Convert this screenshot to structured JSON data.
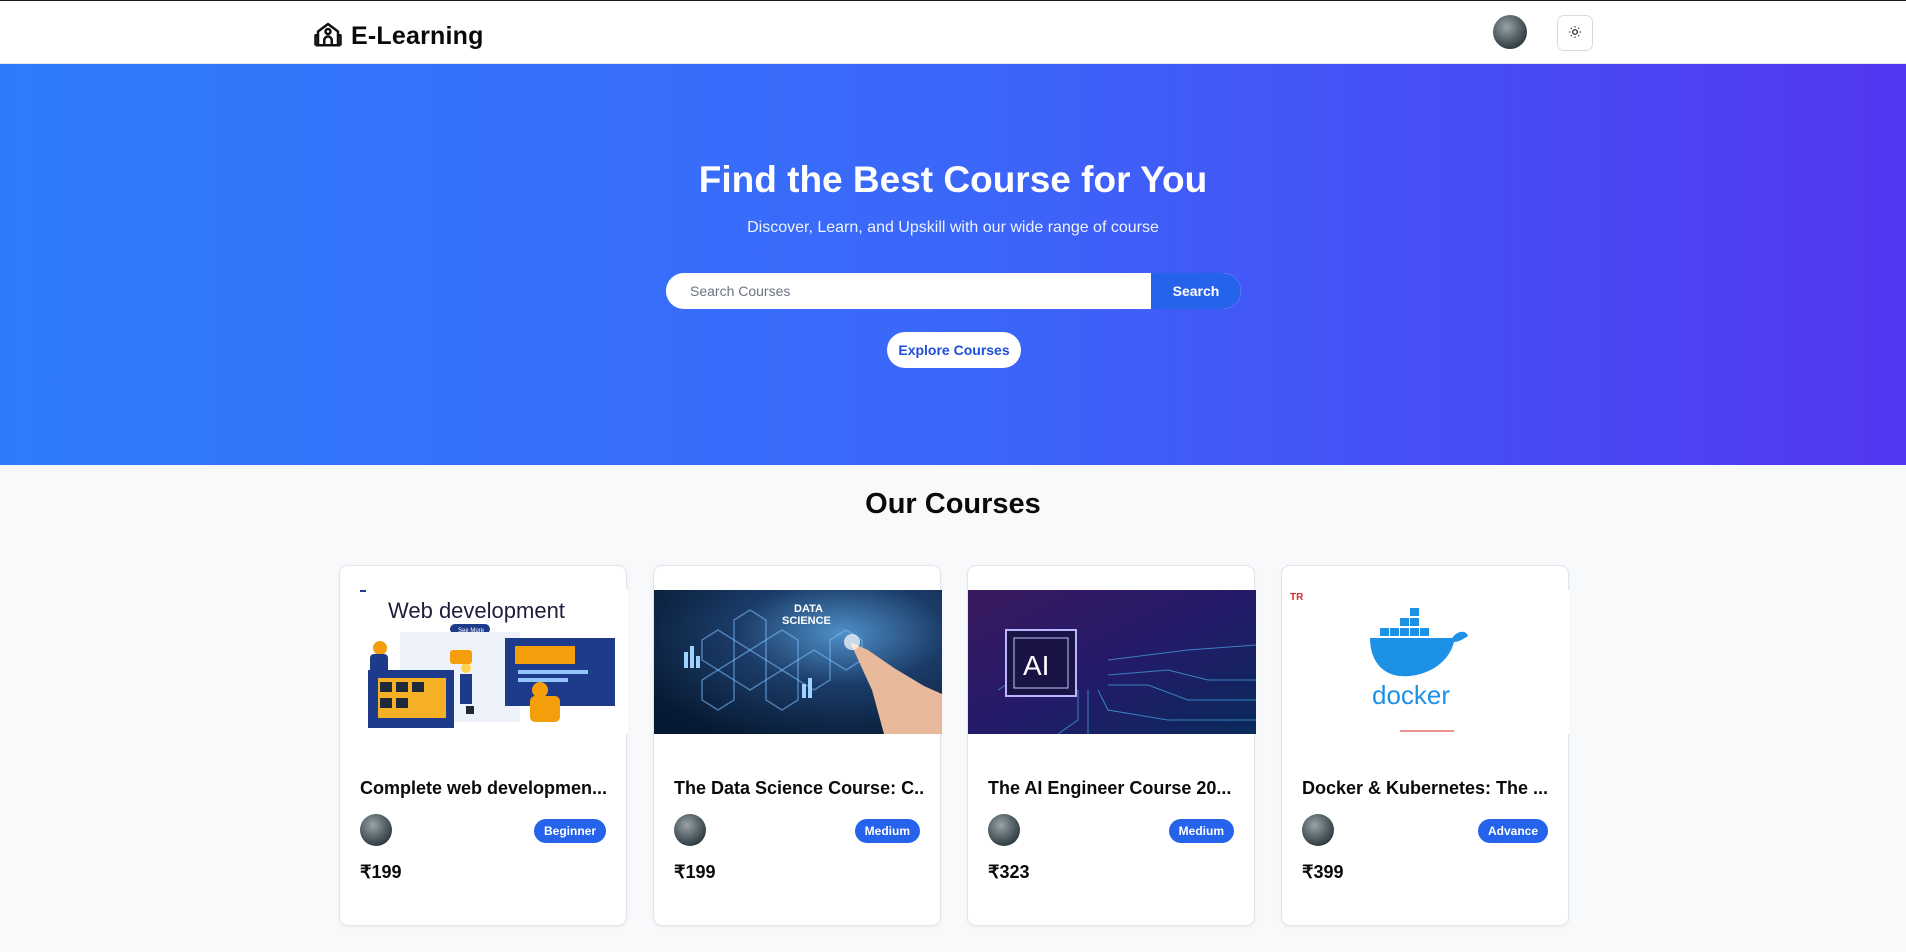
{
  "navbar": {
    "brand": "E-Learning",
    "brand_icon": "school-icon",
    "theme_icon": "sun-icon"
  },
  "hero": {
    "title": "Find the Best Course for You",
    "subtitle": "Discover, Learn, and Upskill with our wide range of course",
    "search_placeholder": "Search Courses",
    "search_value": "",
    "search_button": "Search",
    "explore_button": "Explore Courses"
  },
  "courses": {
    "title": "Our Courses",
    "items": [
      {
        "title": "Complete web developmen...",
        "level": "Beginner",
        "price": "₹199",
        "thumb_text": "Web development",
        "thumb_button": "See More"
      },
      {
        "title": "The Data Science Course: C...",
        "level": "Medium",
        "price": "₹199",
        "thumb_text_1": "DATA",
        "thumb_text_2": "SCIENCE"
      },
      {
        "title": "The AI Engineer Course 20...",
        "level": "Medium",
        "price": "₹323",
        "thumb_text": "AI"
      },
      {
        "title": "Docker & Kubernetes: The ...",
        "level": "Advance",
        "price": "₹399",
        "thumb_text": "docker",
        "thumb_badge": "TR"
      }
    ]
  },
  "colors": {
    "primary": "#2563eb",
    "hero_start": "#2f7cfb",
    "hero_end": "#5237f2"
  }
}
